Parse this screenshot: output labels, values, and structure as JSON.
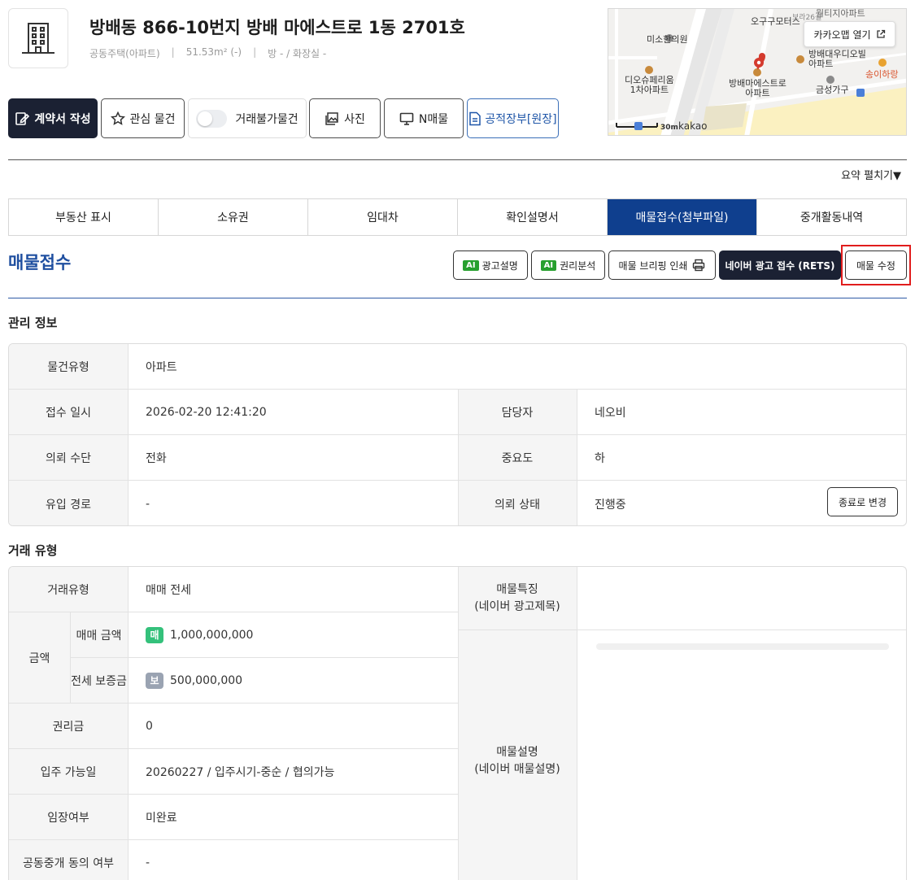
{
  "header": {
    "title": "방배동 866-10번지 방배 마에스트로 1동 2701호",
    "property_type": "공동주택(아파트)",
    "area": "51.53m² (-)",
    "rooms": "방 - / 화장실 -",
    "separator": "|"
  },
  "toolbar": {
    "contract_label": "계약서 작성",
    "favorite_label": "관심 물건",
    "untradeable_label": "거래불가물건",
    "photo_label": "사진",
    "nlisting_label": "N매물",
    "ledger_label": "공적장부[원장]"
  },
  "map": {
    "open_label": "카카오맵 열기",
    "scale_label": "30m",
    "brand": "kakao",
    "labels": {
      "clinic": "미소한의원",
      "motors": "오구구모터스",
      "dio": "디오슈페리움\n1차아파트",
      "maestro": "방배마에스트로\n아파트",
      "daewoo": "방배대우디오빌\n아파트",
      "geumseong": "금성가구",
      "songi": "송이하랑",
      "top1": "월티지아파트",
      "top2": "보라26길"
    }
  },
  "summary_toggle": "요약 펼치기▼",
  "tabs": [
    {
      "label": "부동산 표시"
    },
    {
      "label": "소유권"
    },
    {
      "label": "임대차"
    },
    {
      "label": "확인설명서"
    },
    {
      "label": "매물접수(첨부파일)"
    },
    {
      "label": "중개활동내역"
    }
  ],
  "section": {
    "title": "매물접수",
    "ai_badge": "AI",
    "ad_desc_label": "광고설명",
    "rights_label": "권리분석",
    "briefing_label": "매물 브리핑 인쇄",
    "naver_label": "네이버 광고 접수 (RETS)",
    "edit_label": "매물 수정"
  },
  "management": {
    "heading": "관리 정보",
    "type_label": "물건유형",
    "type_value": "아파트",
    "date_label": "접수 일시",
    "date_value": "2026-02-20 12:41:20",
    "manager_label": "담당자",
    "manager_value": "네오비",
    "method_label": "의뢰 수단",
    "method_value": "전화",
    "priority_label": "중요도",
    "priority_value": "하",
    "route_label": "유입 경로",
    "route_value": "-",
    "status_label": "의뢰 상태",
    "status_value": "진행중",
    "change_label": "종료로 변경"
  },
  "deal": {
    "heading": "거래 유형",
    "type_label": "거래유형",
    "type_value": "매매 전세",
    "amount_label": "금액",
    "sale_label": "매매 금액",
    "sale_chip": "매",
    "sale_value": "1,000,000,000",
    "deposit_label": "전세 보증금",
    "deposit_chip": "보",
    "deposit_value": "500,000,000",
    "premium_label": "권리금",
    "premium_value": "0",
    "movein_label": "입주 가능일",
    "movein_value": "20260227 / 입주시기-중순 / 협의가능",
    "lease_label": "임장여부",
    "lease_value": "미완료",
    "coop_label": "공동중개 동의 여부",
    "coop_value": "-",
    "feature_label_1": "매물특징",
    "feature_label_2": "(네이버 광고제목)",
    "desc_label_1": "매물설명",
    "desc_label_2": "(네이버 매물설명)"
  },
  "colors": {
    "primary_dark": "#1b2133",
    "tab_active": "#0f3f8e",
    "section_title": "#1f4fa0",
    "highlight": "#e11d1d",
    "ai_green": "#27a02e"
  }
}
